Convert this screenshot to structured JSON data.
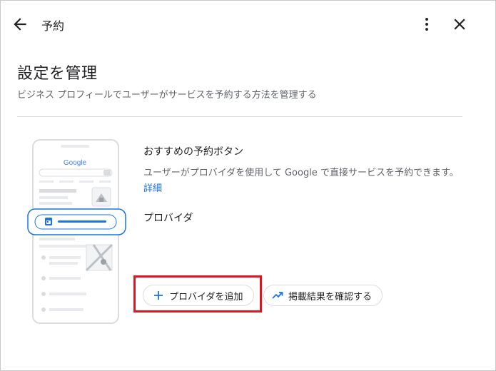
{
  "header": {
    "back_icon": "arrow-left-icon",
    "title": "予約",
    "more_icon": "more-vert-icon",
    "close_icon": "close-icon"
  },
  "page": {
    "title": "設定を管理",
    "subtitle": "ビジネス プロフィールでユーザーがサービスを予約する方法を管理する"
  },
  "illustration": {
    "google_logo_text": "Google",
    "calendar_icon": "calendar-icon"
  },
  "booking": {
    "section_title": "おすすめの予約ボタン",
    "description": "ユーザーがプロバイダを使用して Google で直接サービスを予約できます。",
    "details_link": "詳細",
    "providers_label": "プロバイダ"
  },
  "actions": {
    "add_provider_label": "プロバイダを追加",
    "add_provider_icon": "plus-icon",
    "check_listing_label": "掲載結果を確認する",
    "check_listing_icon": "trending-up-icon",
    "highlight_color": "#e0141e"
  },
  "colors": {
    "accent": "#1a73e8",
    "text_primary": "#202124",
    "text_secondary": "#5f6368"
  }
}
